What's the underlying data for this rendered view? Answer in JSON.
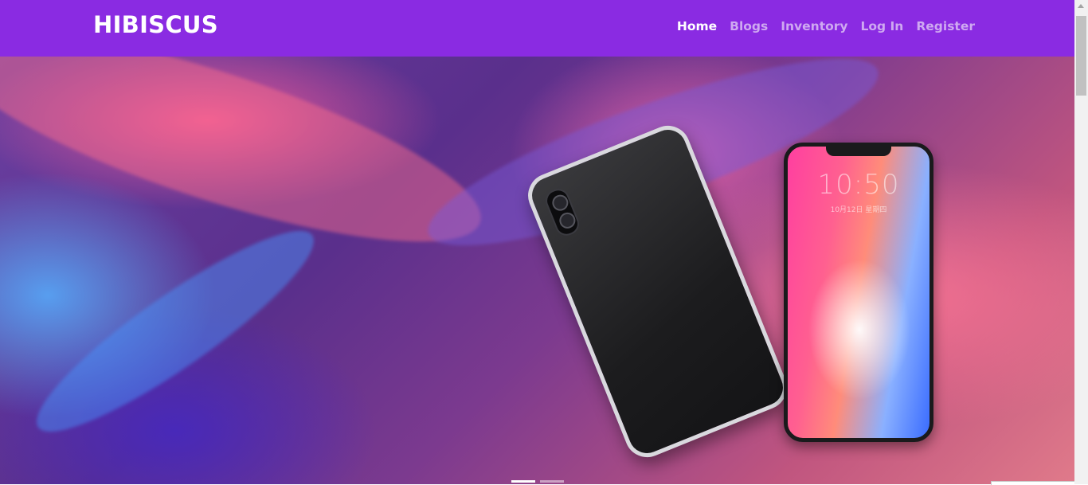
{
  "brand": "HIBISCUS",
  "nav": {
    "links": [
      "Home",
      "Blogs",
      "Inventory",
      "Log In",
      "Register"
    ],
    "active": "Home"
  },
  "hero": {
    "phone_time": "10:50",
    "phone_date": "10月12日 星期四",
    "slides_total": 2,
    "active_slide": 1
  },
  "colors": {
    "navbar_bg": "#8a2be2",
    "nav_link": "#cfa9f1",
    "nav_link_active": "#ffffff"
  },
  "icons": [
    "scroll-up-arrow-icon",
    "phone-camera-icon"
  ]
}
